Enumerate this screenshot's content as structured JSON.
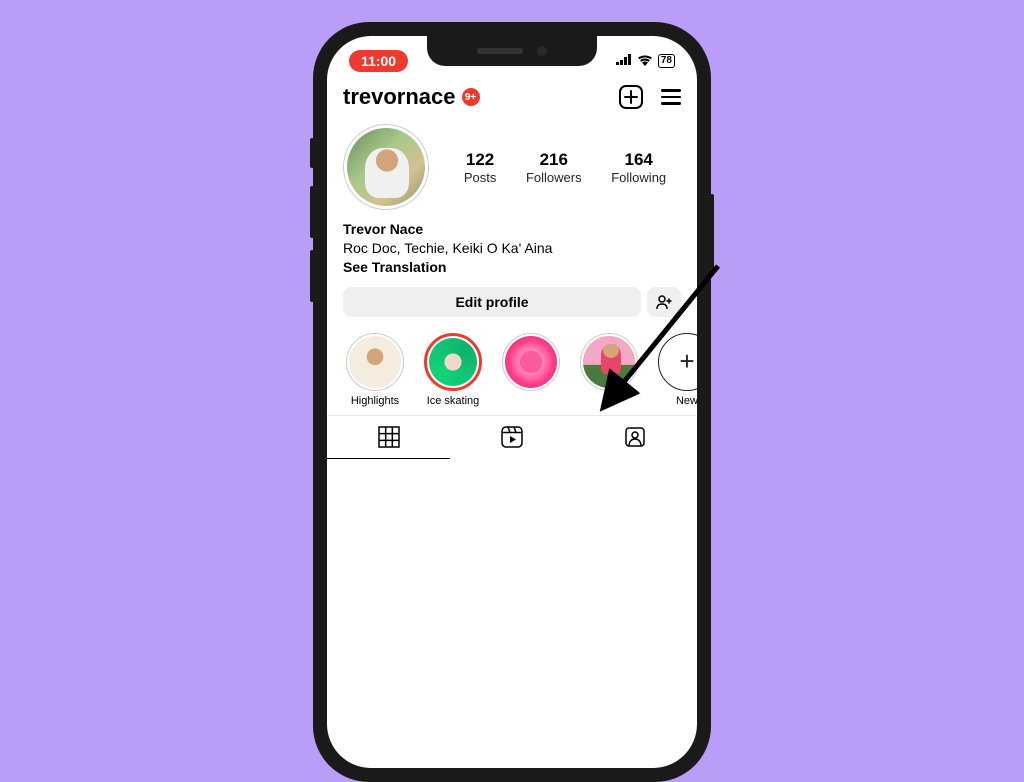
{
  "status": {
    "time": "11:00",
    "battery": "78"
  },
  "header": {
    "username": "trevornace",
    "notif_badge": "9+"
  },
  "stats": {
    "posts": {
      "count": "122",
      "label": "Posts"
    },
    "followers": {
      "count": "216",
      "label": "Followers"
    },
    "following": {
      "count": "164",
      "label": "Following"
    }
  },
  "bio": {
    "display_name": "Trevor Nace",
    "tagline": "Roc Doc, Techie, Keiki O Ka' Aina",
    "translate_label": "See Translation"
  },
  "actions": {
    "edit_profile": "Edit profile"
  },
  "highlights": [
    {
      "label": "Highlights"
    },
    {
      "label": "Ice skating"
    },
    {
      "label": ""
    },
    {
      "label": ""
    },
    {
      "label": "New"
    }
  ],
  "annotation": {
    "target": "highlight-ice-skating"
  }
}
